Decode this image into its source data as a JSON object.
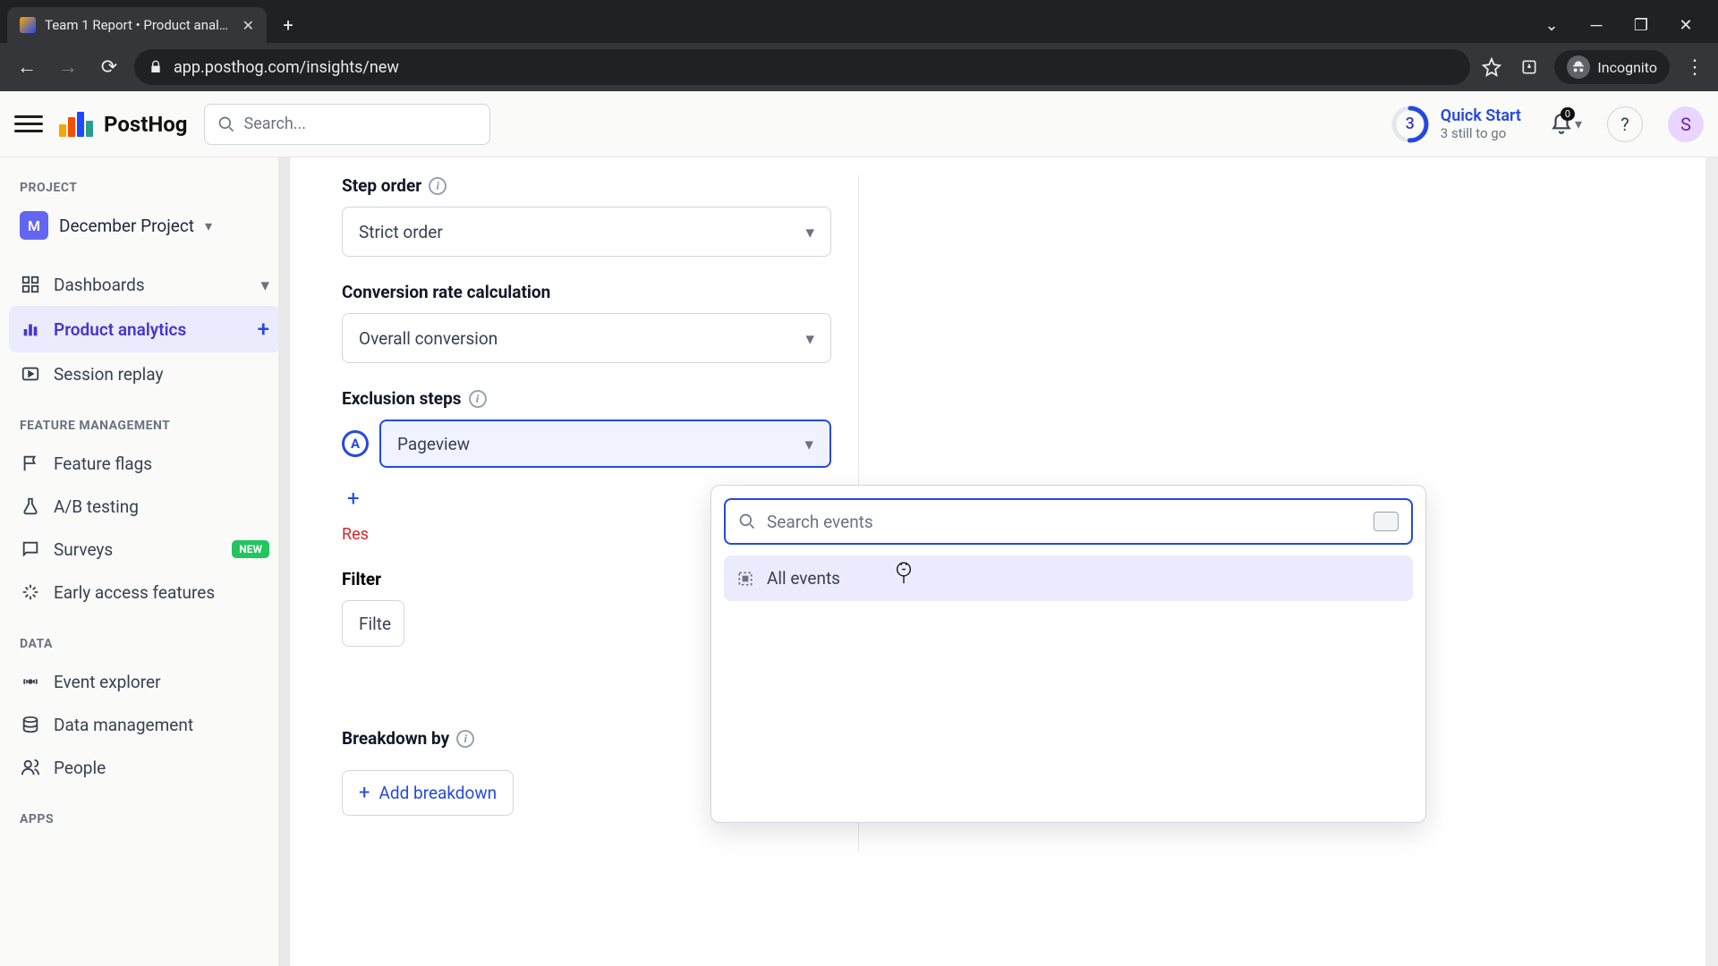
{
  "browser": {
    "tab_title": "Team 1 Report • Product analytic",
    "url": "app.posthog.com/insights/new",
    "incognito_label": "Incognito"
  },
  "header": {
    "brand": "PostHog",
    "search_placeholder": "Search...",
    "quick_start": {
      "count": "3",
      "title": "Quick Start",
      "subtitle": "3 still to go"
    },
    "notif_count": "0",
    "avatar_initial": "S"
  },
  "sidebar": {
    "section_project": "PROJECT",
    "project_initial": "M",
    "project_name": "December Project",
    "items": {
      "dashboards": "Dashboards",
      "product_analytics": "Product analytics",
      "session_replay": "Session replay"
    },
    "section_feature": "FEATURE MANAGEMENT",
    "feature_items": {
      "feature_flags": "Feature flags",
      "ab_testing": "A/B testing",
      "surveys": "Surveys",
      "surveys_badge": "NEW",
      "early_access": "Early access features"
    },
    "section_data": "DATA",
    "data_items": {
      "event_explorer": "Event explorer",
      "data_management": "Data management",
      "people": "People"
    },
    "section_apps": "APPS"
  },
  "panel": {
    "step_order_label": "Step order",
    "step_order_value": "Strict order",
    "conv_label": "Conversion rate calculation",
    "conv_value": "Overall conversion",
    "exclusion_label": "Exclusion steps",
    "exclusion_badge": "A",
    "exclusion_value": "Pageview",
    "reset": "Res",
    "filters_label": "Filter",
    "filter_row": "Filte",
    "breakdown_label": "Breakdown by",
    "add_breakdown": "Add breakdown"
  },
  "dropdown": {
    "search_placeholder": "Search events",
    "item_all_events": "All events"
  }
}
